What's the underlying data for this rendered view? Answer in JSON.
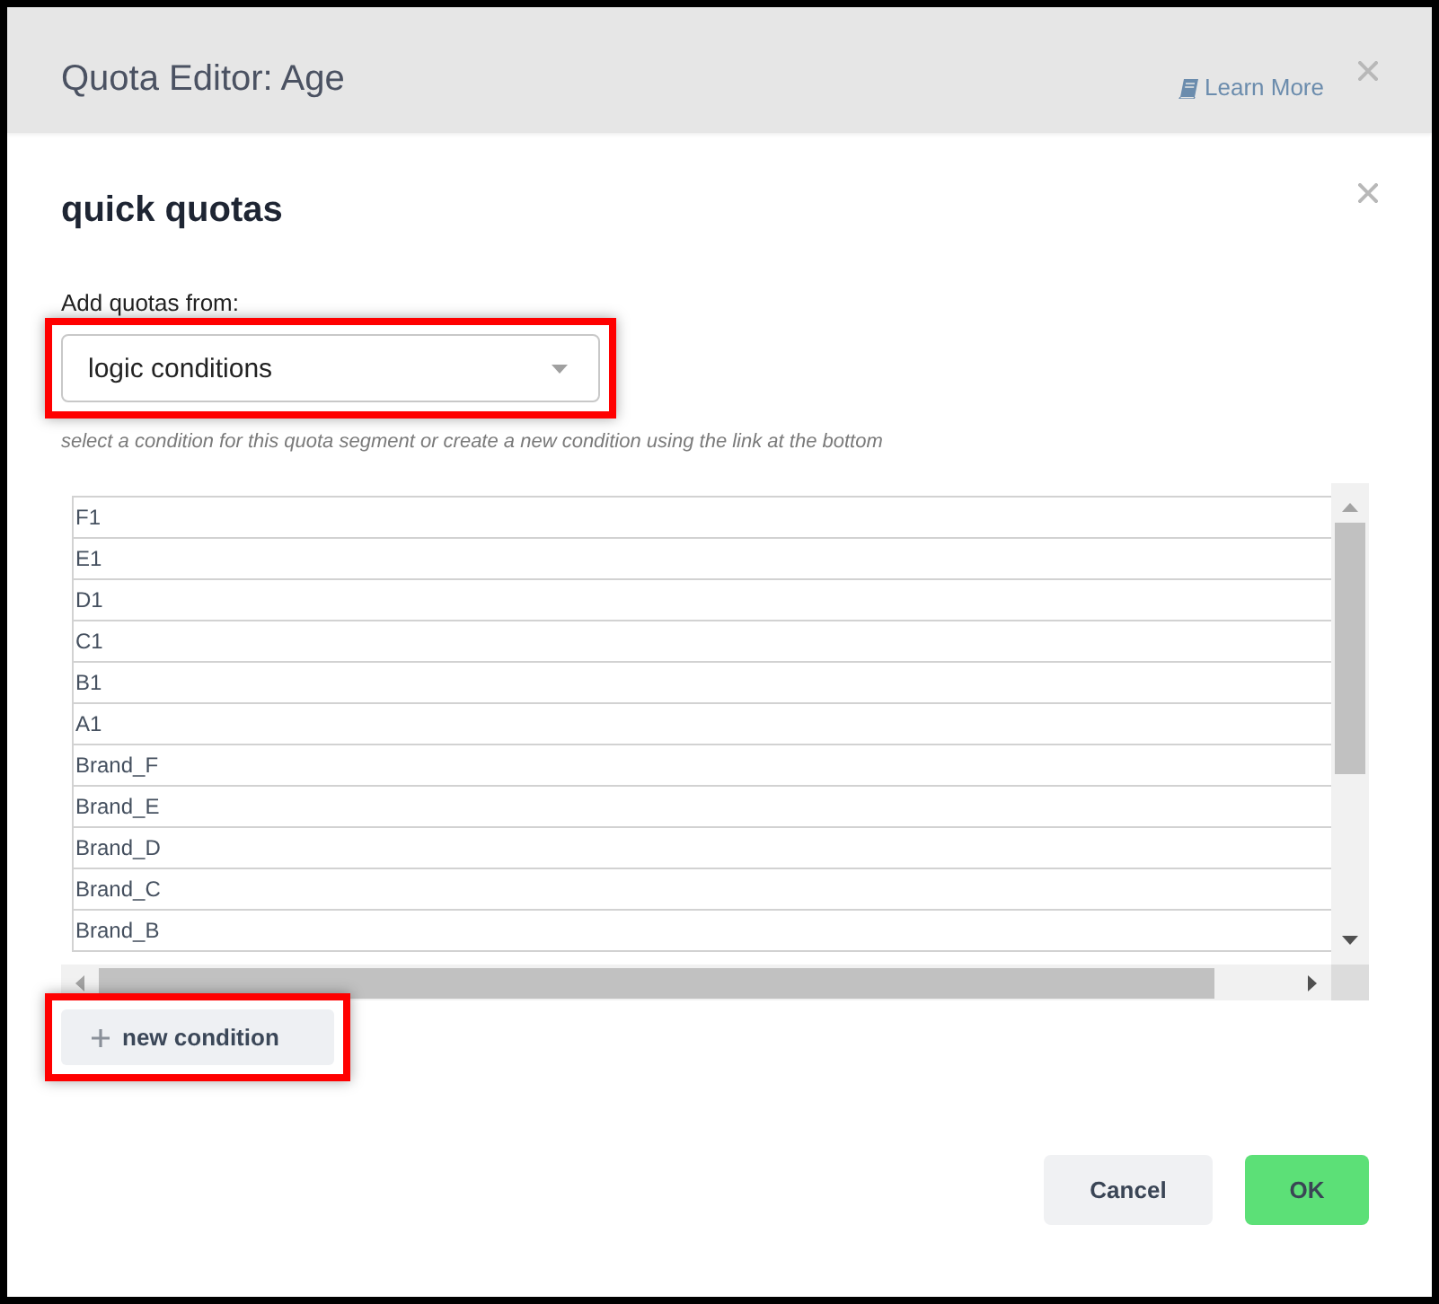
{
  "window": {
    "title": "Quota Editor: Age",
    "help_link": "Learn More"
  },
  "panel": {
    "title": "quick quotas",
    "source_label": "Add quotas from:",
    "source_select": {
      "value": "logic conditions",
      "highlighted": true
    },
    "hint": "select a condition for this quota segment or create a new condition using the link at the bottom",
    "conditions": [
      "F1",
      "E1",
      "D1",
      "C1",
      "B1",
      "A1",
      "Brand_F",
      "Brand_E",
      "Brand_D",
      "Brand_C",
      "Brand_B"
    ],
    "new_condition_button": {
      "label": "new condition",
      "highlighted": true
    }
  },
  "buttons": [
    {
      "label": "Cancel",
      "kind": "secondary"
    },
    {
      "label": "OK",
      "kind": "primary"
    }
  ]
}
